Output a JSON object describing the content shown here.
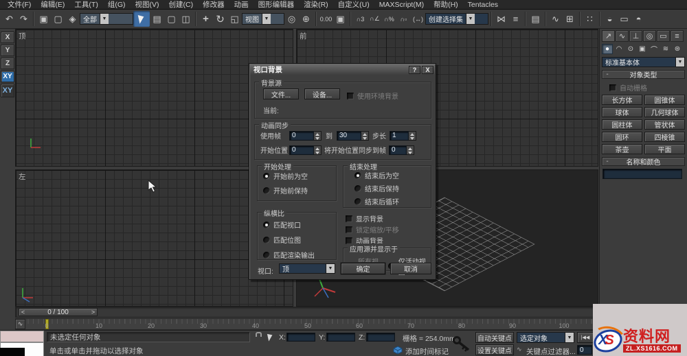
{
  "menu": {
    "items": [
      "文件(F)",
      "编辑(E)",
      "工具(T)",
      "组(G)",
      "视图(V)",
      "创建(C)",
      "修改器",
      "动画",
      "图形编辑器",
      "渲染(R)",
      "自定义(U)",
      "MAXScript(M)",
      "帮助(H)",
      "Tentacles"
    ]
  },
  "icons": {
    "undo": "↶",
    "redo": "↷",
    "link": "▣",
    "unlink": "▢",
    "bind": "◈",
    "select_by_name": "▤",
    "rect_region": "▢",
    "window_crossing": "◫",
    "move": "+",
    "rotate": "↻",
    "scale": "◱",
    "pivot": "◎",
    "manipulate": "⊕",
    "spinner_snap": "0.00",
    "snap_toggle": "▣",
    "snap_3d": "∩3",
    "angle_snap": "∩∠",
    "percent_snap": "∩%",
    "spinner_snap2": "∩▫",
    "kbd_override": "(↔)",
    "mirror": "⋈",
    "align": "≡",
    "layers": "▤",
    "curve_editor": "∿",
    "schematic": "⊞",
    "material": "∷",
    "render_setup": "◒",
    "rendered_frame": "▭",
    "quick_render": "◓",
    "dropdown_arrow": "▼",
    "help": "?",
    "close": "X",
    "minus": "-",
    "left_arrow": "<",
    "right_arrow": ">",
    "play_start": "|◀◀",
    "play_prev": "◀",
    "play_next": "▶|",
    "mini_curve": "∿",
    "tab_create": "↗",
    "tab_modify": "∿",
    "tab_hierarchy": "⊥",
    "tab_motion": "◎",
    "tab_display": "▭",
    "tab_utilities": "≡",
    "cat_geometry": "●",
    "cat_shapes": "◠",
    "cat_lights": "⊙",
    "cat_cameras": "▣",
    "cat_helpers": "⌒",
    "cat_spacewarps": "≋",
    "cat_systems": "⊛",
    "key_filter_curve": "∿"
  },
  "toolbar": {
    "selection_filter": "全部",
    "ref_coord": "视图",
    "named_selection": "创建选择集"
  },
  "axis_toolbar": {
    "x": "X",
    "y": "Y",
    "z": "Z",
    "xy": "XY",
    "snap": "∩",
    "snap_label": "XY"
  },
  "viewports": {
    "top_label": "顶",
    "front_label": "前",
    "left_label": "左"
  },
  "dialog": {
    "title": "视口背景",
    "bg_source": {
      "legend": "背景源",
      "file_btn": "文件...",
      "device_btn": "设备...",
      "env_checkbox": "使用环境背景",
      "current_label": "当前:"
    },
    "anim_sync": {
      "legend": "动画同步",
      "use_frame": "使用帧",
      "use_frame_value": "0",
      "to": "到",
      "to_value": "30",
      "step": "步长",
      "step_value": "1",
      "start_at": "开始位置",
      "start_at_value": "0",
      "sync_start": "将开始位置同步到帧",
      "sync_start_value": "0"
    },
    "start_processing": {
      "legend": "开始处理",
      "options": [
        "开始前为空",
        "开始前保持"
      ]
    },
    "end_processing": {
      "legend": "结束处理",
      "options": [
        "结束后为空",
        "结束后保持",
        "结束后循环"
      ]
    },
    "aspect_ratio": {
      "legend": "纵横比",
      "options": [
        "匹配视口",
        "匹配位图",
        "匹配渲染输出"
      ]
    },
    "display_checkboxes": [
      "显示背景",
      "锁定缩放/平移",
      "动画背景"
    ],
    "apply_to": {
      "legend": "应用源并显示于",
      "options": [
        "所有视图",
        "仅活动视图"
      ]
    },
    "viewport_label": "视口:",
    "viewport_value": "顶",
    "ok": "确定",
    "cancel": "取消"
  },
  "panel": {
    "category": "标准基本体",
    "object_type": {
      "header": "对象类型",
      "autogrid": "自动栅格",
      "buttons": [
        "长方体",
        "圆锥体",
        "球体",
        "几何球体",
        "圆柱体",
        "管状体",
        "圆环",
        "四棱锥",
        "茶壶",
        "平面"
      ]
    },
    "name_color": {
      "header": "名称和颜色",
      "swatch_style": "background:#c53a5e;"
    }
  },
  "timeline": {
    "slider_label": "0 / 100",
    "ticks": [
      "0",
      "10",
      "20",
      "30",
      "40",
      "50",
      "60",
      "70",
      "80",
      "90",
      "100"
    ]
  },
  "statusbar": {
    "status": "未选定任何对象",
    "prompt": "单击或单击并拖动以选择对象",
    "x_label": "X:",
    "y_label": "Y:",
    "z_label": "Z:",
    "grid_label": "栅格 = 254.0mm",
    "add_time_tag": "添加时间标记",
    "auto_key": "自动关键点",
    "set_key": "设置关键点",
    "key_mode": "选定对象",
    "key_filters": "关键点过滤器...",
    "frame_value": "0"
  },
  "watermark": {
    "x": "X",
    "s": "S",
    "site_name": "资料网",
    "site_url": "ZL.XS1616.COM"
  },
  "colors": {
    "accent_blue": "#3f6ea5",
    "swatch": "#c53a5e",
    "marker_yellow": "#b3ad25",
    "watermark_red": "#c51f1f"
  }
}
